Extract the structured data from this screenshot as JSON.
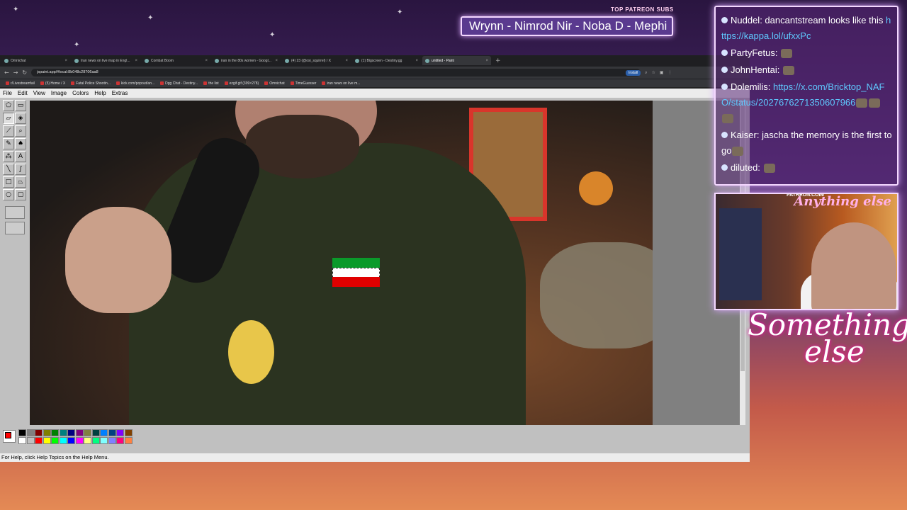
{
  "overlay": {
    "patreon_label": "TOP PATREON SUBS",
    "ticker_text": "Wrynn - Nimrod Nir - Noba D - Mephi",
    "logo_line1": "Something",
    "logo_line2": "else",
    "cam_patreon": "PATREON.COM/",
    "cam_brand": "Anything else"
  },
  "browser": {
    "tabs": [
      {
        "label": "Omnichat",
        "active": false
      },
      {
        "label": "Iran news on live map in Engl...",
        "active": false
      },
      {
        "label": "Combat Boom",
        "active": false
      },
      {
        "label": "iran in the 80s women - Googl...",
        "active": false
      },
      {
        "label": "(4) 23 (@osi_squirrel) / X",
        "active": false
      },
      {
        "label": "(1) Bigscreen - Destiny.gg",
        "active": false
      },
      {
        "label": "untitled - Paint",
        "active": true
      }
    ],
    "new_tab": "+",
    "url": "jspaint.app/#local:8b048c28706aa8",
    "install_label": "Install",
    "bookmarks": [
      "r/Livestreamfail",
      "(5) Home / X",
      "Fatal Police Shootin...",
      "kick.com/popout/an...",
      "Dgg Chat - Destiny...",
      "the list",
      "ezgif.gif (399×278)",
      "Omnichat",
      "TimeGuesser",
      "iran news on live m..."
    ]
  },
  "paint": {
    "menu": [
      "File",
      "Edit",
      "View",
      "Image",
      "Colors",
      "Help",
      "Extras"
    ],
    "tools": [
      {
        "icon": "free-form-select-icon",
        "glyph": "⬠"
      },
      {
        "icon": "select-icon",
        "glyph": "▭"
      },
      {
        "icon": "eraser-icon",
        "glyph": "▱"
      },
      {
        "icon": "fill-icon",
        "glyph": "◈"
      },
      {
        "icon": "pick-color-icon",
        "glyph": "⟋"
      },
      {
        "icon": "magnifier-icon",
        "glyph": "⌕"
      },
      {
        "icon": "pencil-icon",
        "glyph": "✎"
      },
      {
        "icon": "brush-icon",
        "glyph": "♠"
      },
      {
        "icon": "airbrush-icon",
        "glyph": "⁂"
      },
      {
        "icon": "text-icon",
        "glyph": "A"
      },
      {
        "icon": "line-icon",
        "glyph": "╲"
      },
      {
        "icon": "curve-icon",
        "glyph": "∫"
      },
      {
        "icon": "rectangle-icon",
        "glyph": "□"
      },
      {
        "icon": "polygon-icon",
        "glyph": "⏢"
      },
      {
        "icon": "ellipse-icon",
        "glyph": "○"
      },
      {
        "icon": "rounded-rectangle-icon",
        "glyph": "▢"
      }
    ],
    "palette_colors": [
      "#000000",
      "#808080",
      "#800000",
      "#808000",
      "#008000",
      "#008080",
      "#000080",
      "#800080",
      "#808040",
      "#004040",
      "#0080ff",
      "#004080",
      "#8000ff",
      "#804000",
      "#ffffff",
      "#c0c0c0",
      "#ff0000",
      "#ffff00",
      "#00ff00",
      "#00ffff",
      "#0000ff",
      "#ff00ff",
      "#ffff80",
      "#00ff80",
      "#80ffff",
      "#8080ff",
      "#ff0080",
      "#ff8040"
    ],
    "foreground_color": "#ff0000",
    "background_color": "#ffffff",
    "status_text": "For Help, click Help Topics on the Help Menu."
  },
  "chat": {
    "messages": [
      {
        "user": "Nuddel",
        "text": "dancantstream looks like this",
        "link": "https://kappa.lol/ufxxPc",
        "emotes": 0
      },
      {
        "user": "PartyFetus",
        "text": "",
        "link": "",
        "emotes": 1
      },
      {
        "user": "JohnHentai",
        "text": "",
        "link": "",
        "emotes": 1
      },
      {
        "user": "Dolemilis",
        "text": "",
        "link": "https://x.com/Bricktop_NAFO/status/2027676271350607966",
        "emotes": 3
      },
      {
        "user": "Kaiser",
        "text": "jascha  the memory is the first to go",
        "link": "",
        "emotes": 1
      },
      {
        "user": "diluted",
        "text": "",
        "link": "",
        "emotes": 1
      }
    ]
  }
}
